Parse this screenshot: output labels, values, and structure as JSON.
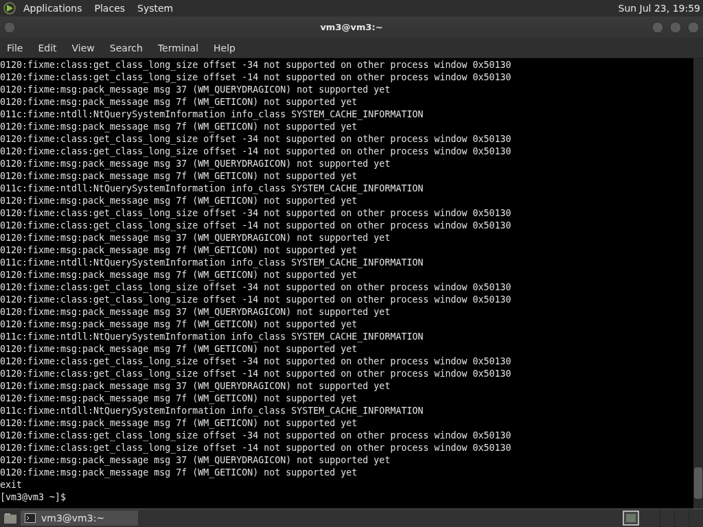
{
  "top_panel": {
    "menus": [
      "Applications",
      "Places",
      "System"
    ],
    "clock": "Sun Jul 23, 19:59"
  },
  "window": {
    "title": "vm3@vm3:~"
  },
  "menu_bar": [
    "File",
    "Edit",
    "View",
    "Search",
    "Terminal",
    "Help"
  ],
  "terminal": {
    "lines": [
      "0120:fixme:class:get_class_long_size offset -34 not supported on other process window 0x50130",
      "0120:fixme:class:get_class_long_size offset -14 not supported on other process window 0x50130",
      "0120:fixme:msg:pack_message msg 37 (WM_QUERYDRAGICON) not supported yet",
      "0120:fixme:msg:pack_message msg 7f (WM_GETICON) not supported yet",
      "011c:fixme:ntdll:NtQuerySystemInformation info_class SYSTEM_CACHE_INFORMATION",
      "0120:fixme:msg:pack_message msg 7f (WM_GETICON) not supported yet",
      "0120:fixme:class:get_class_long_size offset -34 not supported on other process window 0x50130",
      "0120:fixme:class:get_class_long_size offset -14 not supported on other process window 0x50130",
      "0120:fixme:msg:pack_message msg 37 (WM_QUERYDRAGICON) not supported yet",
      "0120:fixme:msg:pack_message msg 7f (WM_GETICON) not supported yet",
      "011c:fixme:ntdll:NtQuerySystemInformation info_class SYSTEM_CACHE_INFORMATION",
      "0120:fixme:msg:pack_message msg 7f (WM_GETICON) not supported yet",
      "0120:fixme:class:get_class_long_size offset -34 not supported on other process window 0x50130",
      "0120:fixme:class:get_class_long_size offset -14 not supported on other process window 0x50130",
      "0120:fixme:msg:pack_message msg 37 (WM_QUERYDRAGICON) not supported yet",
      "0120:fixme:msg:pack_message msg 7f (WM_GETICON) not supported yet",
      "011c:fixme:ntdll:NtQuerySystemInformation info_class SYSTEM_CACHE_INFORMATION",
      "0120:fixme:msg:pack_message msg 7f (WM_GETICON) not supported yet",
      "0120:fixme:class:get_class_long_size offset -34 not supported on other process window 0x50130",
      "0120:fixme:class:get_class_long_size offset -14 not supported on other process window 0x50130",
      "0120:fixme:msg:pack_message msg 37 (WM_QUERYDRAGICON) not supported yet",
      "0120:fixme:msg:pack_message msg 7f (WM_GETICON) not supported yet",
      "011c:fixme:ntdll:NtQuerySystemInformation info_class SYSTEM_CACHE_INFORMATION",
      "0120:fixme:msg:pack_message msg 7f (WM_GETICON) not supported yet",
      "0120:fixme:class:get_class_long_size offset -34 not supported on other process window 0x50130",
      "0120:fixme:class:get_class_long_size offset -14 not supported on other process window 0x50130",
      "0120:fixme:msg:pack_message msg 37 (WM_QUERYDRAGICON) not supported yet",
      "0120:fixme:msg:pack_message msg 7f (WM_GETICON) not supported yet",
      "011c:fixme:ntdll:NtQuerySystemInformation info_class SYSTEM_CACHE_INFORMATION",
      "0120:fixme:msg:pack_message msg 7f (WM_GETICON) not supported yet",
      "0120:fixme:class:get_class_long_size offset -34 not supported on other process window 0x50130",
      "0120:fixme:class:get_class_long_size offset -14 not supported on other process window 0x50130",
      "0120:fixme:msg:pack_message msg 37 (WM_QUERYDRAGICON) not supported yet",
      "0120:fixme:msg:pack_message msg 7f (WM_GETICON) not supported yet",
      "exit"
    ],
    "prompt": "[vm3@vm3 ~]$"
  },
  "taskbar": {
    "tasks": [
      {
        "label": "vm3@vm3:~",
        "selected": true
      }
    ]
  }
}
